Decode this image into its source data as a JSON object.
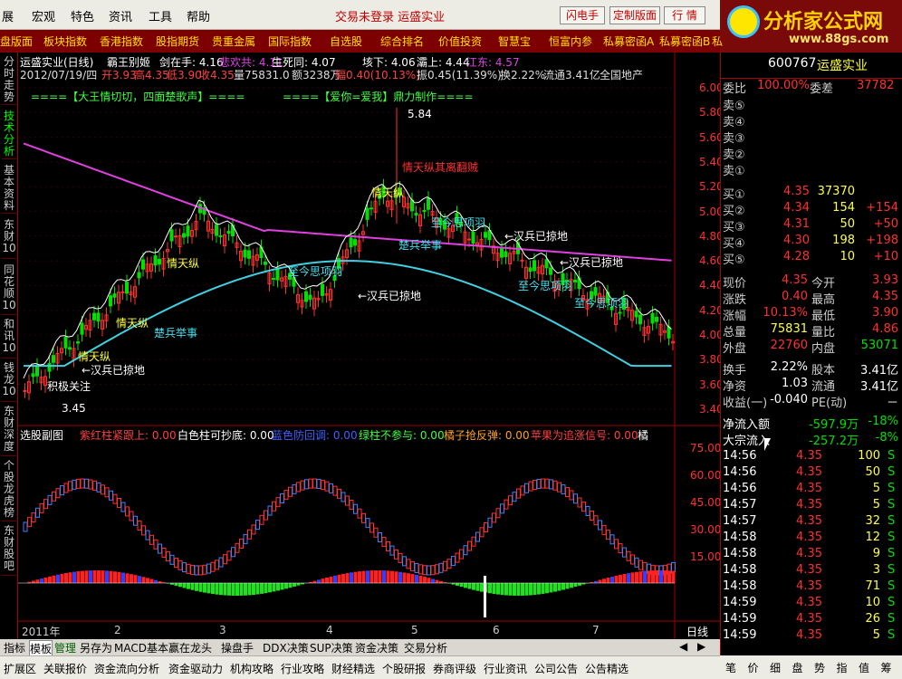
{
  "menubar": {
    "items": [
      "展",
      "宏观",
      "特色",
      "资讯",
      "工具",
      "帮助"
    ],
    "center": "交易未登录 运盛实业",
    "buttons": [
      "闪电手",
      "定制版面",
      "行 情",
      "资 讯"
    ]
  },
  "logo": {
    "main": "分析家公式网",
    "url": "www.88gs.com"
  },
  "navbar": {
    "items": [
      "盘版面",
      "板块指数",
      "香港指数",
      "股指期货",
      "贵重金属",
      "国际指数",
      "自选股",
      "综合排名",
      "价值投资",
      "智慧宝",
      "恒富内参",
      "私募密函A",
      "私募密函B",
      "私"
    ]
  },
  "leftstrip": {
    "items": [
      "分时走势",
      "技术分析",
      "基本资料",
      "东财10",
      "同花顺10",
      "和讯10",
      "钱龙10",
      "东财深度",
      "个股龙虎榜",
      "东财股吧"
    ]
  },
  "chart": {
    "header_line1": {
      "name": "运盛实业(日线)",
      "ind": "霸王别姬",
      "v1": "剑在手: 4.16",
      "v2": "悲欢共: 4.11",
      "v3": "生死同: 4.07",
      "v4": "垓下: 4.06",
      "v5": "灞上: 4.44",
      "v6": "江东: 4.57"
    },
    "header_line2": {
      "date": "2012/07/19/四",
      "open": "开3.93",
      "high": "高4.35",
      "low": "低3.90",
      "close": "收4.35",
      "vol": "量75831.0",
      "amt": "额3238万",
      "chg": "幅0.40(10.13%)",
      "amp": "振0.45(11.39%)",
      "turn": "换2.22%",
      "float": "流通3.41亿",
      "sector": "全国地产"
    },
    "banner_left": "====【大王情切切，四面楚歌声】====",
    "banner_right": "====【爱你=爱我】鼎力制作====",
    "price_axis": [
      "6.00",
      "5.80",
      "5.60",
      "5.40",
      "5.20",
      "5.00",
      "4.80",
      "4.60",
      "4.40",
      "4.20",
      "4.00",
      "3.80",
      "3.60",
      "3.40"
    ],
    "annotations": {
      "high_label": "5.84",
      "low_label": "3.45",
      "a1": "←汉兵已掠地",
      "a2": "←汉兵已掠地",
      "a3": "←汉兵已掠地",
      "a4": "←汉兵已掠地",
      "b1": "楚兵举事",
      "b2": "楚兵举事",
      "c1": "至今思项羽",
      "c2": "至今思项羽",
      "c3": "至今思项羽",
      "c4": "至今思项羽",
      "d1": "情天纵",
      "d2": "情天纵",
      "d3": "情天纵",
      "d4": "情天纵",
      "e1": "情天纵其离翻贼",
      "f1": "积极关注"
    },
    "sub_header": {
      "title": "选股副图",
      "v1": "紫红柱紧跟上: 0.00",
      "v2": "白色柱可抄底: 0.00",
      "v3": "蓝色防回调: 0.00",
      "v4": "绿柱不参与: 0.00",
      "v5": "橘子抢反弹: 0.00",
      "v6": "苹果为追涨信号: 0.00",
      "v7": "橘"
    },
    "sub_axis": [
      "75.00",
      "60.00",
      "45.00",
      "30.00",
      "15.00"
    ],
    "time_axis": [
      "2011年",
      "2",
      "3",
      "4",
      "5",
      "6",
      "7"
    ],
    "period": "日线"
  },
  "quote": {
    "code": "600767",
    "name": "运盛实业",
    "weibi_label": "委比",
    "weibi": "100.00%",
    "weicha_label": "委差",
    "weicha": "37782",
    "asks": [
      {
        "label": "卖⑤"
      },
      {
        "label": "卖④"
      },
      {
        "label": "卖③"
      },
      {
        "label": "卖②"
      },
      {
        "label": "卖①"
      }
    ],
    "bids": [
      {
        "label": "买①",
        "price": "4.35",
        "vol": "37370",
        "chg": ""
      },
      {
        "label": "买②",
        "price": "4.34",
        "vol": "154",
        "chg": "+154"
      },
      {
        "label": "买③",
        "price": "4.31",
        "vol": "50",
        "chg": "+50"
      },
      {
        "label": "买④",
        "price": "4.30",
        "vol": "198",
        "chg": "+198"
      },
      {
        "label": "买⑤",
        "price": "4.28",
        "vol": "10",
        "chg": "+10"
      }
    ],
    "stats": [
      {
        "l1": "现价",
        "v1": "4.35",
        "l2": "今开",
        "v2": "3.93"
      },
      {
        "l1": "涨跌",
        "v1": "0.40",
        "l2": "最高",
        "v2": "4.35"
      },
      {
        "l1": "涨幅",
        "v1": "10.13%",
        "l2": "最低",
        "v2": "3.90"
      },
      {
        "l1": "总量",
        "v1": "75831",
        "l2": "量比",
        "v2": "4.86"
      },
      {
        "l1": "外盘",
        "v1": "22760",
        "l2": "内盘",
        "v2": "53071"
      }
    ],
    "stats2": [
      {
        "l1": "换手",
        "v1": "2.22%",
        "l2": "股本",
        "v2": "3.41亿"
      },
      {
        "l1": "净资",
        "v1": "1.03",
        "l2": "流通",
        "v2": "3.41亿"
      },
      {
        "l1": "收益(一)",
        "v1": "-0.040",
        "l2": "PE(动)",
        "v2": "－"
      }
    ],
    "flow": [
      {
        "label": "净流入额",
        "amount": "-597.9万",
        "pct": "-18%"
      },
      {
        "label": "大宗流入",
        "amount": "-257.2万",
        "pct": "-8%"
      }
    ],
    "ticks": [
      {
        "t": "14:56",
        "p": "4.35",
        "v": "100",
        "s": "S"
      },
      {
        "t": "14:56",
        "p": "4.35",
        "v": "50",
        "s": "S"
      },
      {
        "t": "14:56",
        "p": "4.35",
        "v": "5",
        "s": "S"
      },
      {
        "t": "14:57",
        "p": "4.35",
        "v": "5",
        "s": "S"
      },
      {
        "t": "14:57",
        "p": "4.35",
        "v": "32",
        "s": "S"
      },
      {
        "t": "14:58",
        "p": "4.35",
        "v": "12",
        "s": "S"
      },
      {
        "t": "14:58",
        "p": "4.35",
        "v": "9",
        "s": "S"
      },
      {
        "t": "14:58",
        "p": "4.35",
        "v": "3",
        "s": "S"
      },
      {
        "t": "14:58",
        "p": "4.35",
        "v": "71",
        "s": "S"
      },
      {
        "t": "14:59",
        "p": "4.35",
        "v": "10",
        "s": "S"
      },
      {
        "t": "14:59",
        "p": "4.35",
        "v": "26",
        "s": "S"
      },
      {
        "t": "14:59",
        "p": "4.35",
        "v": "5",
        "s": "S"
      }
    ],
    "tabs": [
      "笔",
      "价",
      "细",
      "盘",
      "势",
      "指",
      "值",
      "筹"
    ]
  },
  "bottomtabs": [
    "指标",
    "模板",
    "管理",
    "另存为",
    "MACD基本",
    "赢在龙头",
    "操盘手",
    "DDX决策",
    "SUP决策",
    "资金决策",
    "交易分析"
  ],
  "statusbar": [
    "扩展区",
    "关联报价",
    "资金流向分析",
    "资金驱动力",
    "机构攻略",
    "行业攻略",
    "财经精选",
    "个股研报",
    "券商评级",
    "行业资讯",
    "公司公告",
    "公告精选"
  ],
  "colors": {
    "accent_red": "#ff2020",
    "up": "#ff3030",
    "down": "#00e000",
    "cyan": "#40e0f0",
    "magenta": "#e040e0",
    "yellow": "#ffff00"
  }
}
